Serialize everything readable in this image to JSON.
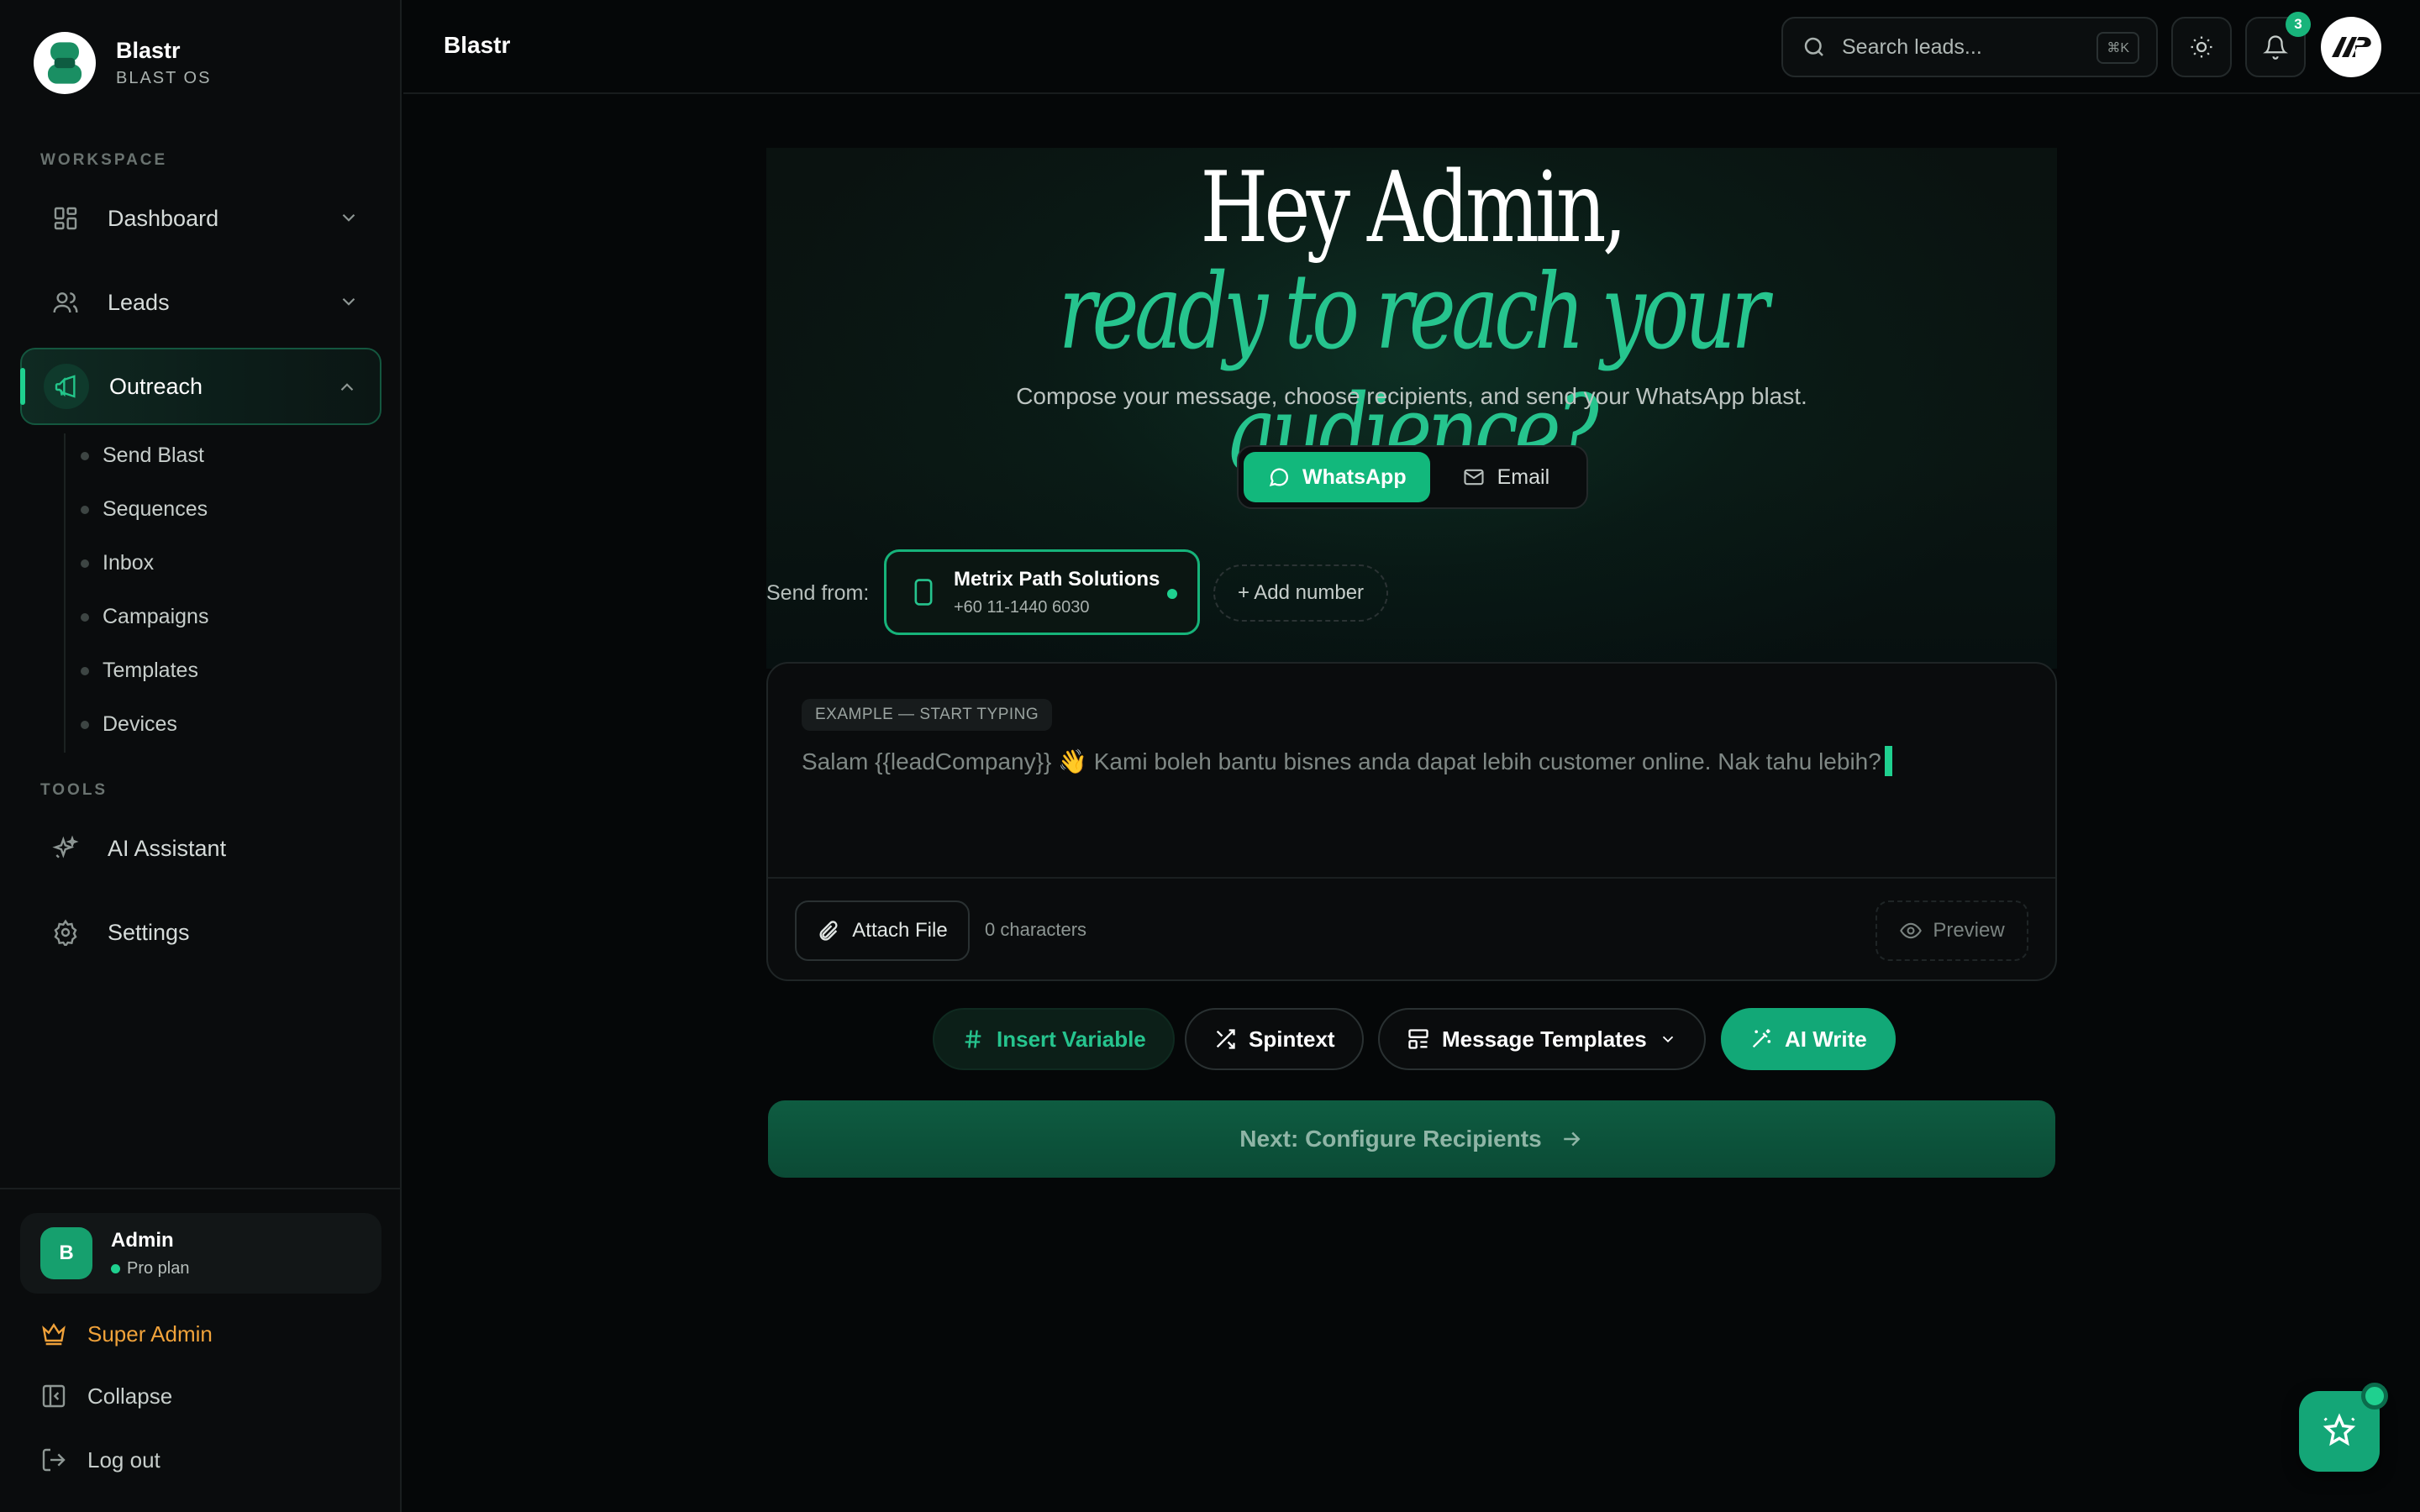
{
  "brand": {
    "name": "Blastr",
    "subtitle": "BLAST OS"
  },
  "sidebar": {
    "workspace_label": "WORKSPACE",
    "tools_label": "TOOLS",
    "items": [
      {
        "label": "Dashboard",
        "icon": "dashboard-icon"
      },
      {
        "label": "Leads",
        "icon": "users-icon"
      },
      {
        "label": "Outreach",
        "icon": "megaphone-icon",
        "active": true
      }
    ],
    "outreach_sub": [
      "Send Blast",
      "Sequences",
      "Inbox",
      "Campaigns",
      "Templates",
      "Devices"
    ],
    "tools": [
      {
        "label": "AI Assistant",
        "icon": "sparkles-icon"
      },
      {
        "label": "Settings",
        "icon": "gear-icon"
      }
    ],
    "user": {
      "initial": "B",
      "name": "Admin",
      "plan": "Pro plan"
    },
    "footer": {
      "super_admin": "Super Admin",
      "collapse": "Collapse",
      "logout": "Log out"
    }
  },
  "topbar": {
    "title": "Blastr",
    "search_placeholder": "Search leads...",
    "search_shortcut": "⌘K",
    "notification_count": "3"
  },
  "hero": {
    "greeting": "Hey Admin,",
    "tagline": "ready to reach your audience?",
    "subtitle": "Compose your message, choose recipients, and send your WhatsApp blast."
  },
  "channels": {
    "whatsapp": "WhatsApp",
    "email": "Email",
    "selected": "WhatsApp"
  },
  "sender": {
    "label": "Send from:",
    "name": "Metrix Path Solutions",
    "number": "+60 11-1440 6030",
    "add_label": "+ Add number"
  },
  "composer": {
    "example_label": "EXAMPLE — START TYPING",
    "placeholder": "Salam {{leadCompany}} 👋 Kami boleh bantu bisnes anda dapat lebih customer online. Nak tahu lebih?",
    "attach_label": "Attach File",
    "char_count": "0 characters",
    "preview_label": "Preview"
  },
  "tools": {
    "insert_variable": "Insert Variable",
    "spintext": "Spintext",
    "message_templates": "Message Templates",
    "ai_write": "AI Write"
  },
  "next_label": "Next: Configure Recipients",
  "colors": {
    "accent": "#12b87c",
    "accent_text": "#26c48e",
    "warning": "#f0a23a",
    "background": "#050708"
  }
}
